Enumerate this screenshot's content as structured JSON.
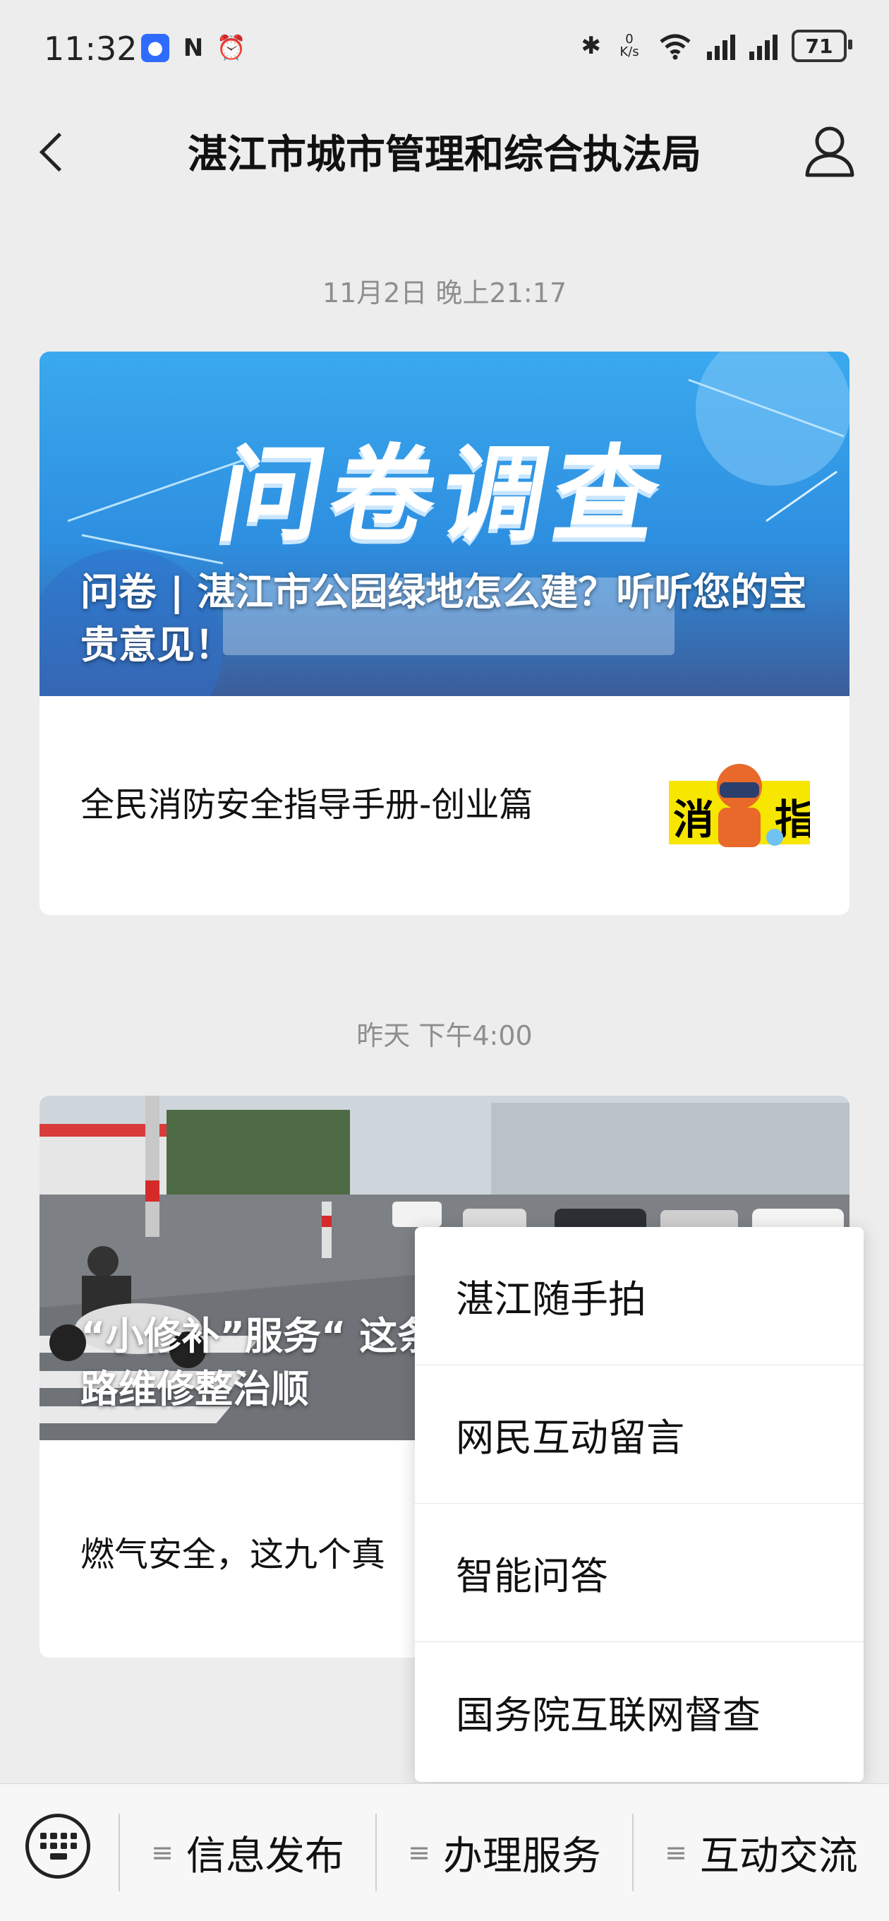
{
  "status_bar": {
    "time": "11:32",
    "speed_value": "0",
    "speed_unit": "K/s",
    "battery": "71",
    "icons": [
      "app-notification-icon",
      "nfc-icon",
      "alarm-icon",
      "bluetooth-icon",
      "wifi-icon",
      "signal-icon"
    ]
  },
  "header": {
    "title": "湛江市城市管理和综合执法局"
  },
  "feed": [
    {
      "timestamp": "11月2日 晚上21:17",
      "hero_title": "问卷 | 湛江市公园绿地怎么建？听听您的宝贵意见！",
      "banner_text": "问卷调查",
      "sub_title": "全民消防安全指导手册-创业篇"
    },
    {
      "timestamp": "昨天 下午4:00",
      "hero_title": "“小修补”服务“ 这条路维修整治顺",
      "sub_title": "燃气安全，这九个真"
    }
  ],
  "menu": {
    "items": [
      "湛江随手拍",
      "网民互动留言",
      "智能问答",
      "国务院互联网督查"
    ]
  },
  "bottom_bar": {
    "tabs": [
      "信息发布",
      "办理服务",
      "互动交流"
    ]
  }
}
